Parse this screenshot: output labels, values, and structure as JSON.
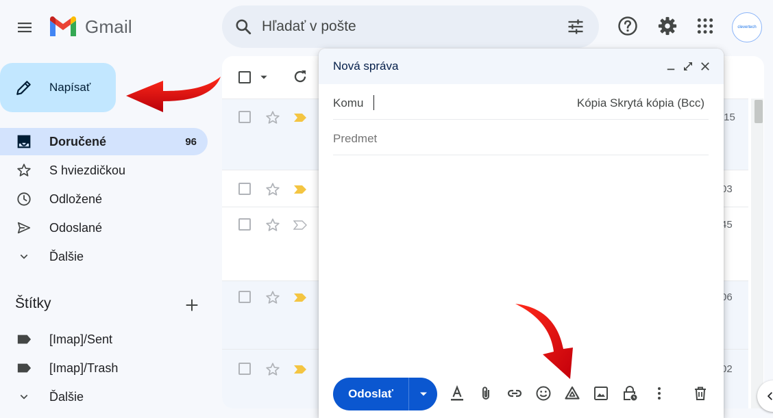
{
  "header": {
    "app_name": "Gmail",
    "search_placeholder": "Hľadať v pošte",
    "avatar_text": "clevertech"
  },
  "compose_button": {
    "label": "Napísať"
  },
  "sidebar": {
    "items": [
      {
        "label": "Doručené",
        "count": "96",
        "icon": "inbox-icon",
        "active": true
      },
      {
        "label": "S hviezdičkou",
        "count": "",
        "icon": "star-icon"
      },
      {
        "label": "Odložené",
        "count": "",
        "icon": "clock-icon"
      },
      {
        "label": "Odoslané",
        "count": "",
        "icon": "send-icon"
      },
      {
        "label": "Ďalšie",
        "count": "",
        "icon": "chevron-down-icon"
      }
    ],
    "labels_title": "Štítky",
    "labels": [
      {
        "label": "[Imap]/Sent",
        "icon": "label-icon"
      },
      {
        "label": "[Imap]/Trash",
        "icon": "label-icon"
      },
      {
        "label": "Ďalšie",
        "icon": "chevron-down-icon"
      }
    ]
  },
  "mail_list": {
    "rows": [
      {
        "time": ":15",
        "important": true
      },
      {
        "time": "03",
        "important": true
      },
      {
        "time": "45",
        "important": false
      },
      {
        "time": "06",
        "important": true
      },
      {
        "time": "02",
        "important": true
      }
    ]
  },
  "compose": {
    "title": "Nová správa",
    "to_label": "Komu",
    "cc_bcc": "Kópia Skrytá kópia (Bcc)",
    "subject_placeholder": "Predmet",
    "send_label": "Odoslať"
  },
  "colors": {
    "accent": "#0b57d0",
    "compose_bg": "#c2e7ff",
    "active_nav": "#d3e3fd",
    "annotation_arrow": "#e8000b"
  }
}
